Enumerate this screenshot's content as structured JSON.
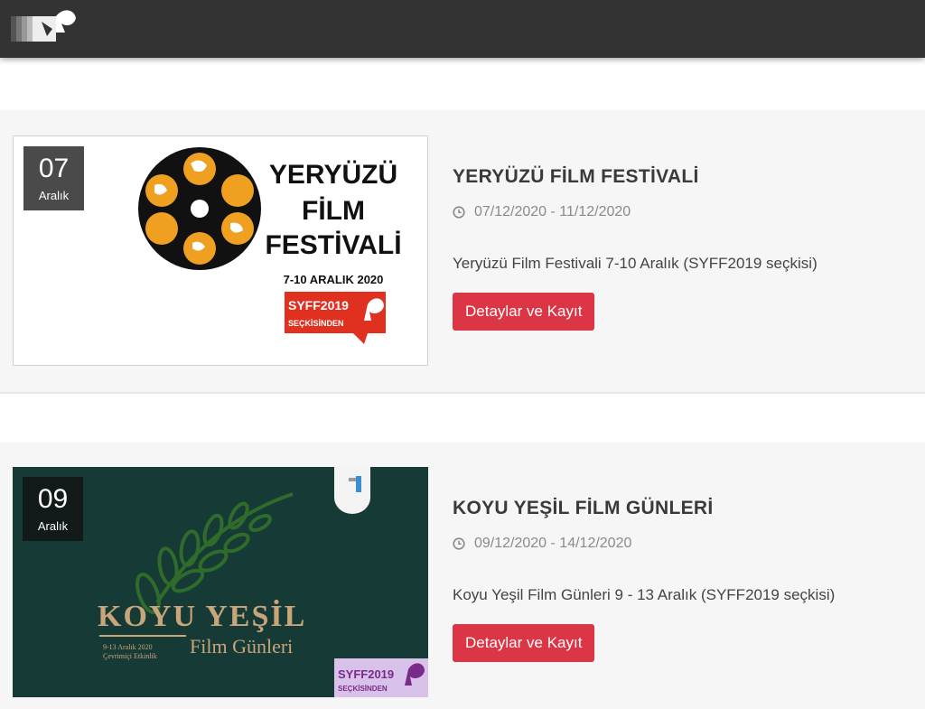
{
  "header": {
    "logo_icon": "festival-logo-icon",
    "bg_color": "#333333"
  },
  "events": [
    {
      "day": "07",
      "month": "Aralık",
      "title": "YERYÜZÜ FİLM FESTİVALİ",
      "dates": "07/12/2020 - 11/12/2020",
      "description": "Yeryüzü Film Festivali 7-10 Aralık (SYFF2019 seçkisi)",
      "button": "Detaylar ve Kayıt",
      "poster": {
        "line1": "YERYÜZÜ",
        "line2": "FİLM",
        "line3": "FESTİVALİ",
        "date_text": "7-10 ARALIK 2020",
        "badge_line1": "SYFF2019",
        "badge_line2": "SEÇKİSİNDEN"
      }
    },
    {
      "day": "09",
      "month": "Aralık",
      "title": "KOYU YEŞİL FİLM GÜNLERİ",
      "dates": "09/12/2020 - 14/12/2020",
      "description": "Koyu Yeşil Film Günleri 9 - 13 Aralık (SYFF2019 seçkisi)",
      "button": "Detaylar ve Kayıt",
      "poster": {
        "line1": "KOYU YEŞİL",
        "line2": "Film Günleri",
        "date_text": "9-13 Aralık 2020",
        "sub_text": "Çevrimiçi Etkinlik",
        "badge_line1": "SYFF2019",
        "badge_line2": "SEÇKİSİNDEN"
      }
    }
  ],
  "colors": {
    "button": "#dc3545",
    "accent_orange": "#f0a020",
    "poster2_bg": "#163a36"
  }
}
